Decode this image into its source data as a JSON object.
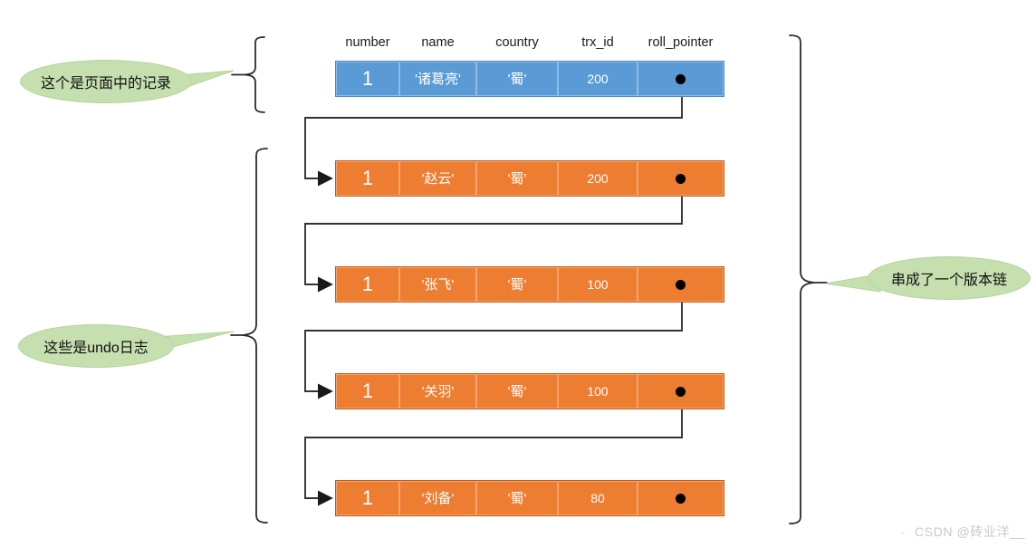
{
  "diagram": {
    "title": "MVCC undo log version chain",
    "colors": {
      "record_fill": "#5B9BD5",
      "undo_fill": "#ED7D31",
      "callout_fill": "#C5DFAF",
      "line": "#404040",
      "pointer_dot": "#000000"
    },
    "columns": [
      {
        "key": "number",
        "label": "number"
      },
      {
        "key": "name",
        "label": "name"
      },
      {
        "key": "country",
        "label": "country"
      },
      {
        "key": "trx_id",
        "label": "trx_id"
      },
      {
        "key": "roll_pointer",
        "label": "roll_pointer"
      }
    ],
    "rows": [
      {
        "kind": "record",
        "number": "1",
        "name": "'诸葛亮'",
        "country": "'蜀'",
        "trx_id": "200",
        "roll_pointer": ""
      },
      {
        "kind": "undo",
        "number": "1",
        "name": "'赵云'",
        "country": "'蜀'",
        "trx_id": "200",
        "roll_pointer": ""
      },
      {
        "kind": "undo",
        "number": "1",
        "name": "'张飞'",
        "country": "'蜀'",
        "trx_id": "100",
        "roll_pointer": ""
      },
      {
        "kind": "undo",
        "number": "1",
        "name": "'关羽'",
        "country": "'蜀'",
        "trx_id": "100",
        "roll_pointer": ""
      },
      {
        "kind": "undo",
        "number": "1",
        "name": "'刘备'",
        "country": "'蜀'",
        "trx_id": "80",
        "roll_pointer": ""
      }
    ],
    "callouts": {
      "record_note": "这个是页面中的记录",
      "undo_note": "这些是undo日志",
      "chain_note": "串成了一个版本链"
    }
  },
  "watermark": {
    "dash": "-",
    "text": "CSDN @砖业洋__"
  }
}
